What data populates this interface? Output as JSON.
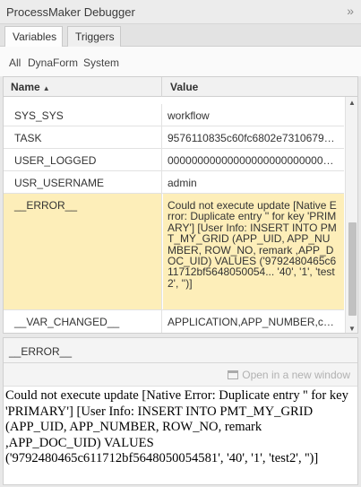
{
  "header": {
    "title": "ProcessMaker Debugger",
    "collapse_icon": "double-chevron-right-icon"
  },
  "tabs": [
    {
      "label": "Variables",
      "active": true
    },
    {
      "label": "Triggers",
      "active": false
    }
  ],
  "filters": [
    "All",
    "DynaForm",
    "System"
  ],
  "grid": {
    "columns": {
      "name": "Name",
      "value": "Value",
      "sort": "ascending"
    },
    "rows": [
      {
        "name": "SYS_SYS",
        "value": "workflow"
      },
      {
        "name": "TASK",
        "value": "9576110835c60fc6802e7310679363..."
      },
      {
        "name": "USER_LOGGED",
        "value": "00000000000000000000000000000..."
      },
      {
        "name": "USR_USERNAME",
        "value": "admin"
      },
      {
        "name": "__ERROR__",
        "value": "Could not execute update [Native Error: Duplicate entry '' for key 'PRIMARY'] [User Info: INSERT INTO PMT_MY_GRID (APP_UID, APP_NUMBER, ROW_NO, remark ,APP_DOC_UID) VALUES ('9792480465c611712bf5648050054... '40', '1', 'test2', '')]",
        "selected": true
      },
      {
        "name": "__VAR_CHANGED__",
        "value": "APPLICATION,APP_NUMBER,contrac..."
      }
    ]
  },
  "detail": {
    "title": "__ERROR__",
    "open_new_window": "Open in a new window",
    "content": "Could not execute update [Native Error: Duplicate entry '' for key 'PRIMARY'] [User Info: INSERT INTO PMT_MY_GRID (APP_UID, APP_NUMBER, ROW_NO, remark ,APP_DOC_UID) VALUES ('9792480465c611712bf5648050054581', '40', '1', 'test2', '')]"
  },
  "colors": {
    "selected_row": "#fdeeb9",
    "panel_bg": "#ececec"
  }
}
